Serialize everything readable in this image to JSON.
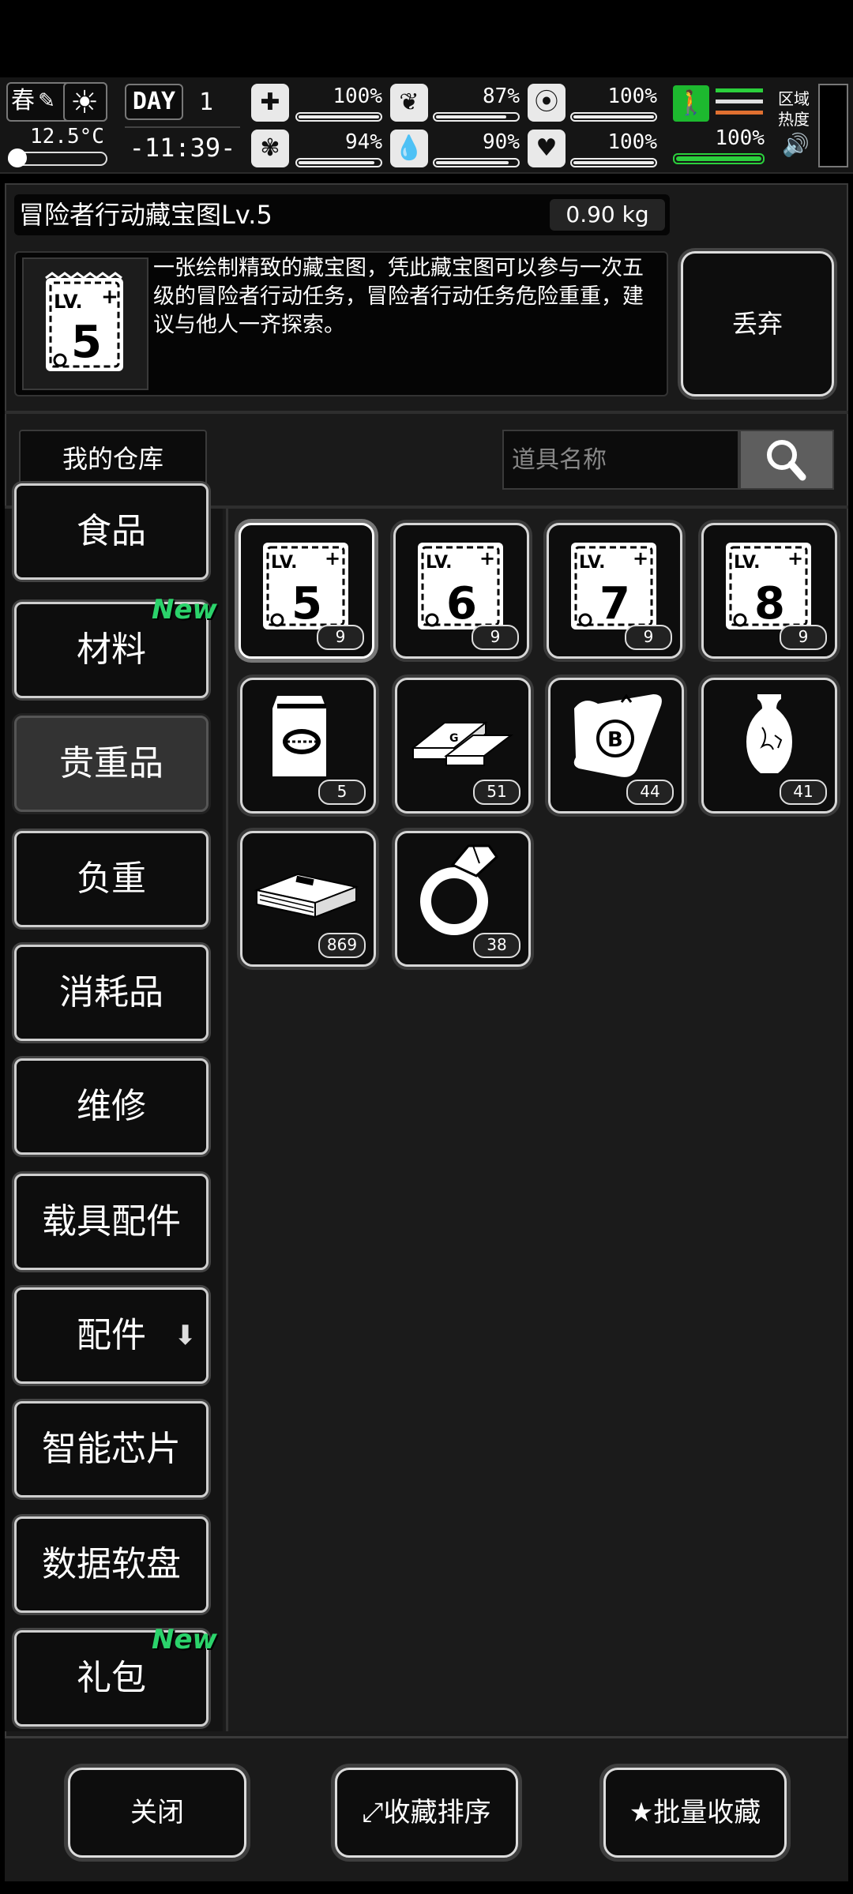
{
  "hud": {
    "season": "春",
    "temperature": "12.5°C",
    "day_label": "DAY",
    "day_number": "1",
    "time": "-11:39-",
    "stats": [
      {
        "icon": "medkit-icon",
        "value": "100%",
        "level": 1.0
      },
      {
        "icon": "stomach-icon",
        "value": "87%",
        "level": 0.87
      },
      {
        "icon": "lungs-icon",
        "value": "100%",
        "level": 1.0
      },
      {
        "icon": "brain-icon",
        "value": "94%",
        "level": 0.94
      },
      {
        "icon": "water-drop-icon",
        "value": "90%",
        "level": 0.9
      },
      {
        "icon": "heart-icon",
        "value": "100%",
        "level": 1.0
      }
    ],
    "stamina": "100%",
    "zone_label": "区域热度"
  },
  "item_detail": {
    "name": "冒险者行动藏宝图Lv.5",
    "weight": "0.90 kg",
    "icon_level": "5",
    "icon_lv_text": "LV.",
    "description": "一张绘制精致的藏宝图，凭此藏宝图可以参与一次五级的冒险者行动任务，冒险者行动任务危险重重，建议与他人一齐探索。",
    "discard_label": "丢弃"
  },
  "warehouse": {
    "label": "我的仓库",
    "search_placeholder": "道具名称"
  },
  "categories": [
    {
      "label": "食品",
      "new": false
    },
    {
      "label": "材料",
      "new": true
    },
    {
      "label": "贵重品",
      "new": false,
      "selected": true
    },
    {
      "label": "负重",
      "new": false
    },
    {
      "label": "消耗品",
      "new": false
    },
    {
      "label": "维修",
      "new": false
    },
    {
      "label": "载具配件",
      "new": false
    },
    {
      "label": "配件",
      "new": false,
      "dropdown": true
    },
    {
      "label": "智能芯片",
      "new": false
    },
    {
      "label": "数据软盘",
      "new": false
    },
    {
      "label": "礼包",
      "new": true
    }
  ],
  "new_badge": "New",
  "items": [
    {
      "icon": "treasure-map-icon",
      "level": "5",
      "count": "9"
    },
    {
      "icon": "treasure-map-icon",
      "level": "6",
      "count": "9"
    },
    {
      "icon": "treasure-map-icon",
      "level": "7",
      "count": "9"
    },
    {
      "icon": "treasure-map-icon",
      "level": "8",
      "count": "9"
    },
    {
      "icon": "coffee-bag-icon",
      "count": "5"
    },
    {
      "icon": "gold-bars-icon",
      "count": "51"
    },
    {
      "icon": "bitcoin-scroll-icon",
      "count": "44"
    },
    {
      "icon": "vase-icon",
      "count": "41"
    },
    {
      "icon": "cash-stack-icon",
      "count": "869"
    },
    {
      "icon": "diamond-ring-icon",
      "count": "38"
    }
  ],
  "bottom": {
    "close_label": "关闭",
    "sort_label": "收藏排序",
    "batch_label": "批量收藏"
  },
  "colors": {
    "accent_green": "#2bd03c",
    "new_badge": "#2bd36b",
    "panel": "#1a1a1a"
  }
}
